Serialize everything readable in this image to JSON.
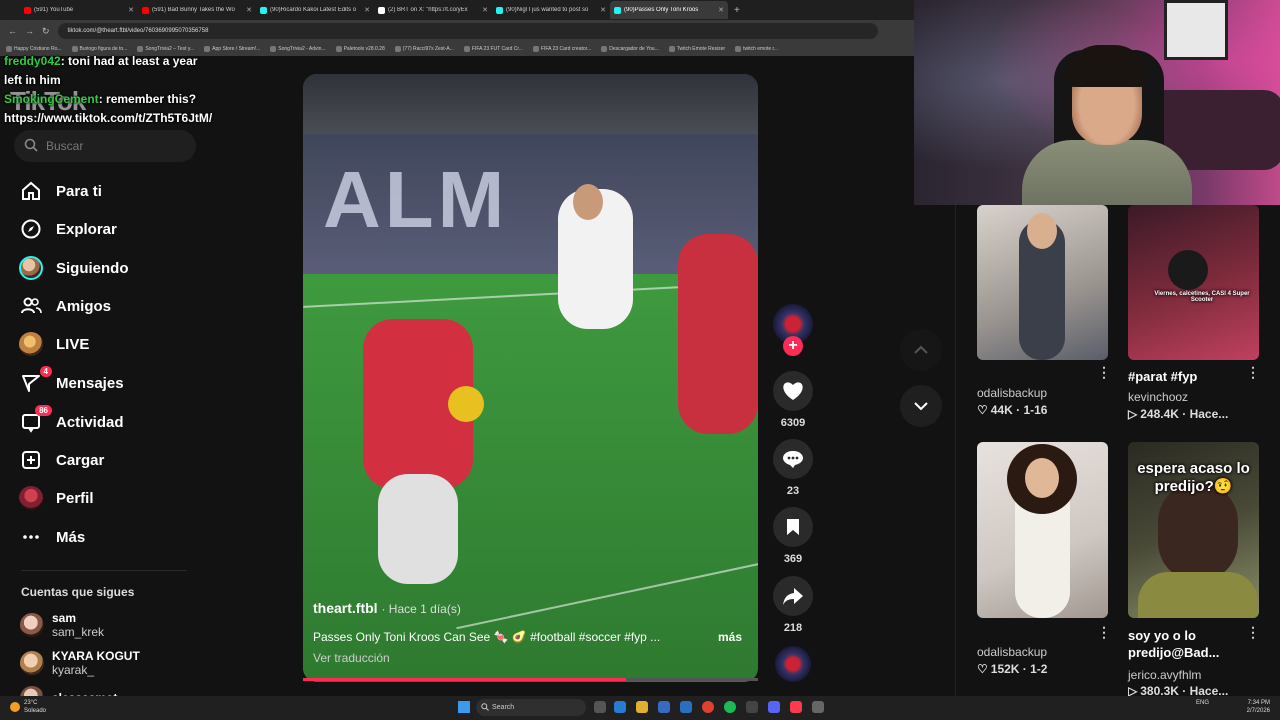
{
  "browser": {
    "tabs": [
      {
        "label": "(591) YouTube",
        "color": "#ff0000"
      },
      {
        "label": "(591) Bad Bunny Takes the Wo",
        "color": "#ff0000"
      },
      {
        "label": "(90)Ricardo Kakoi Latest Edits o",
        "color": "#25f4ee"
      },
      {
        "label": "(2) BRT on X: \"https://t.co/yEx",
        "color": "#ffffff"
      },
      {
        "label": "(90)Nigl I jus wanted to post so",
        "color": "#25f4ee"
      },
      {
        "label": "(90)Passes Only Toni Kroos",
        "color": "#25f4ee",
        "active": true
      }
    ],
    "new_tab": "+",
    "url": "tiktok.com/@theart.ftbl/video/7603690995070356758",
    "bookmarks": [
      "Happy Cristiano Ro...",
      "Buriogo figura de to...",
      "SongTrivia2 – Test y...",
      "App Store / Stream!...",
      "SongTrivia2 - Advin...",
      "Paletools v28.0.28",
      "(77) Racci97s Zest-A...",
      "FIFA 23 FUT Card Cr...",
      "FIFA 23 Card creator...",
      "Descargador de You...",
      "Twitch Emote Resizer",
      "twitch emote r..."
    ]
  },
  "chat": {
    "line1_user": "freddy042",
    "line1_text": ": toni had at least a year left in him",
    "line2_user": "SmokingCement",
    "line2_text": ": remember this? https://www.tiktok.com/t/ZTh5T6JtM/"
  },
  "sidebar": {
    "logo": "TikTok",
    "search_placeholder": "Buscar",
    "items": [
      {
        "label": "Para ti",
        "icon": "home-icon"
      },
      {
        "label": "Explorar",
        "icon": "compass-icon"
      },
      {
        "label": "Siguiendo",
        "icon": "following-avatar"
      },
      {
        "label": "Amigos",
        "icon": "friends-icon"
      },
      {
        "label": "LIVE",
        "icon": "live-avatar"
      },
      {
        "label": "Mensajes",
        "icon": "send-icon",
        "badge": "4"
      },
      {
        "label": "Actividad",
        "icon": "activity-icon",
        "badge": "86"
      },
      {
        "label": "Cargar",
        "icon": "upload-icon"
      },
      {
        "label": "Perfil",
        "icon": "profile-avatar"
      },
      {
        "label": "Más",
        "icon": "more-icon"
      }
    ],
    "following_title": "Cuentas que sigues",
    "following": [
      {
        "name": "sam",
        "handle": "sam_krek"
      },
      {
        "name": "KYARA KOGUT",
        "handle": "kyarak_"
      },
      {
        "name": "alessaamot",
        "handle": ""
      }
    ]
  },
  "video": {
    "author": "theart.ftbl",
    "time": "· Hace 1 día(s)",
    "caption": "Passes Only Toni Kroos Can See 🍬 🥑 #football #soccer #fyp ...",
    "more": "más",
    "translate": "Ver traducción",
    "progress": 0.71,
    "board_text": "ALM"
  },
  "actions": {
    "follow": "+",
    "likes": "6309",
    "comments": "23",
    "saves": "369",
    "shares": "218"
  },
  "feed": [
    {
      "title": "",
      "user": "odalisbackup",
      "stats": "44K · 1-16",
      "colors": [
        "#cfc6c0",
        "#3b3f4a"
      ]
    },
    {
      "title": "#parat #fyp",
      "user": "kevinchooz",
      "stats": "248.4K · Hace...",
      "colors": [
        "#5a2030",
        "#c03050"
      ],
      "overlay": "Viernes, calcetines, CASI 4 Super Scooter"
    },
    {
      "title": "",
      "user": "odalisbackup",
      "stats": "152K · 1-2",
      "colors": [
        "#d8d0cc",
        "#e8e0dc"
      ]
    },
    {
      "title": "soy yo o lo predijo@Bad...",
      "user": "jerico.avyfhlm",
      "stats": "380.3K · Hace...",
      "colors": [
        "#3a3a30",
        "#7a8060"
      ],
      "overlay": "espera acaso lo predijo?🤨"
    }
  ],
  "taskbar": {
    "weather_temp": "23°C",
    "weather_desc": "Soleado",
    "search": "Search",
    "lang": "ENG",
    "time": "7:34 PM",
    "date": "2/7/2026"
  },
  "colors": {
    "accent": "#fe2c55",
    "background": "#121212"
  }
}
